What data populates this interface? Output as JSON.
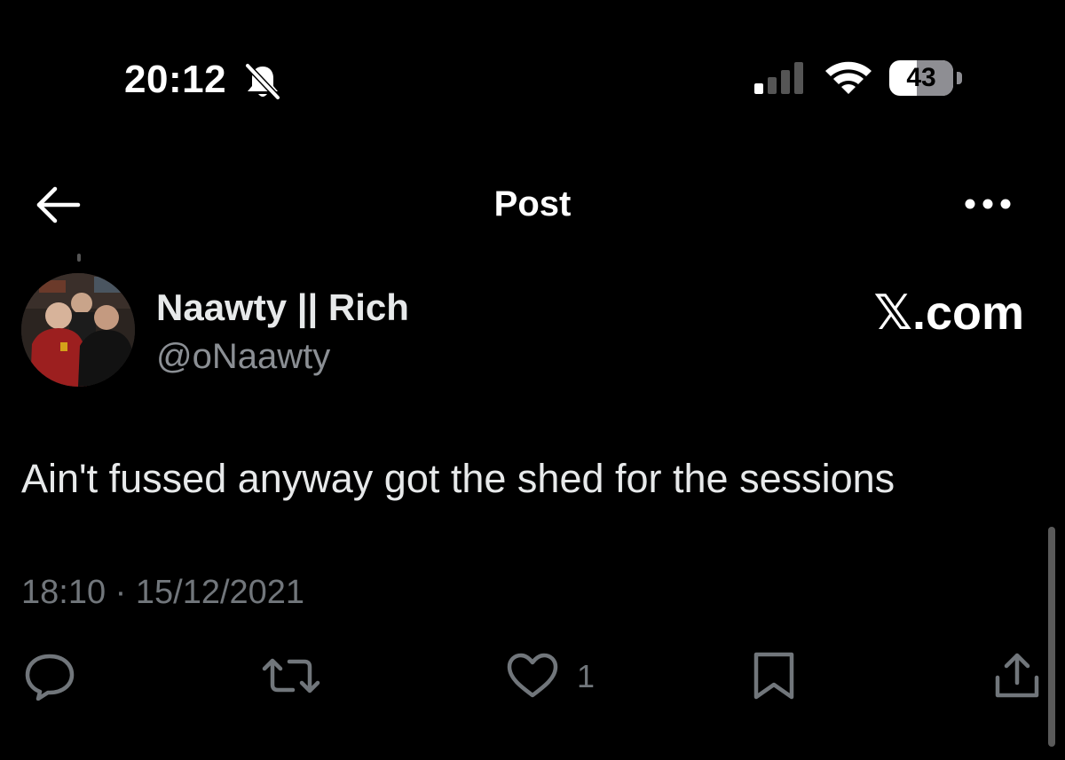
{
  "status_bar": {
    "time": "20:12",
    "battery": "43",
    "icons": [
      "bell-muted-icon",
      "signal-icon",
      "wifi-icon",
      "battery-icon"
    ]
  },
  "header": {
    "title": "Post",
    "back_icon": "arrow-left-icon",
    "more_icon": "more-horizontal-icon"
  },
  "author": {
    "display_name": "Naawty || Rich",
    "handle": "@oNaawty"
  },
  "brand": "𝕏.com",
  "post": {
    "text": "Ain't fussed anyway got the shed for the sessions",
    "timestamp": "18:10 · 15/12/2021"
  },
  "actions": {
    "reply_icon": "reply-icon",
    "repost_icon": "repost-icon",
    "like_icon": "heart-icon",
    "like_count": "1",
    "bookmark_icon": "bookmark-icon",
    "share_icon": "share-icon"
  },
  "colors": {
    "background": "#000000",
    "primary_text": "#e7e9ea",
    "secondary_text": "#71767b"
  }
}
